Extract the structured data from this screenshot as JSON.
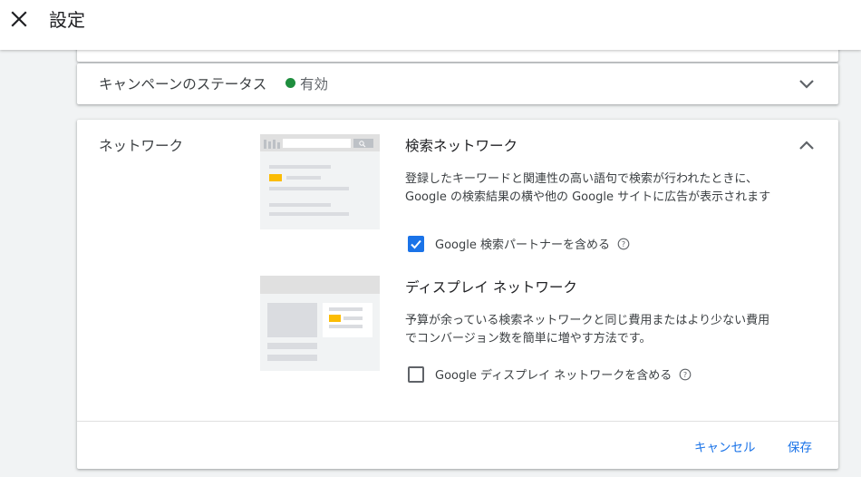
{
  "header": {
    "title": "設定",
    "close_icon": "close-icon"
  },
  "status_section": {
    "label": "キャンペーンのステータス",
    "value": "有効",
    "dot_color": "#1e8e3e"
  },
  "network_section": {
    "label": "ネットワーク",
    "search": {
      "title": "検索ネットワーク",
      "description": "登録したキーワードと関連性の高い語句で検索が行われたときに、Google の検索結果の横や他の Google サイトに広告が表示されます",
      "checkbox_label": "Google 検索パートナーを含める",
      "checked": true
    },
    "display": {
      "title": "ディスプレイ ネットワーク",
      "description": "予算が余っている検索ネットワークと同じ費用またはより少ない費用でコンバージョン数を簡単に増やす方法です。",
      "checkbox_label": "Google ディスプレイ ネットワークを含める",
      "checked": false
    }
  },
  "actions": {
    "cancel_label": "キャンセル",
    "save_label": "保存"
  },
  "colors": {
    "accent": "#1a73e8",
    "highlight": "#fbbc04"
  }
}
